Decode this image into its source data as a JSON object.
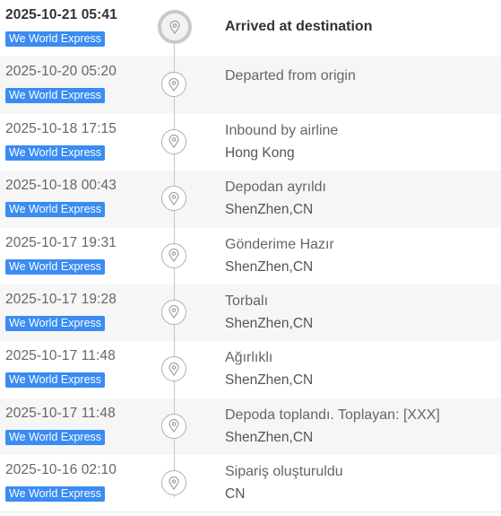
{
  "tracking": {
    "events": [
      {
        "time": "2025-10-21 05:41",
        "carrier": "We World Express",
        "status": "Arrived at destination",
        "location": ""
      },
      {
        "time": "2025-10-20 05:20",
        "carrier": "We World Express",
        "status": "Departed from origin",
        "location": ""
      },
      {
        "time": "2025-10-18 17:15",
        "carrier": "We World Express",
        "status": "Inbound by airline",
        "location": "Hong Kong"
      },
      {
        "time": "2025-10-18 00:43",
        "carrier": "We World Express",
        "status": "Depodan ayrıldı",
        "location": "ShenZhen,CN"
      },
      {
        "time": "2025-10-17 19:31",
        "carrier": "We World Express",
        "status": "Gönderime Hazır",
        "location": "ShenZhen,CN"
      },
      {
        "time": "2025-10-17 19:28",
        "carrier": "We World Express",
        "status": "Torbalı",
        "location": "ShenZhen,CN"
      },
      {
        "time": "2025-10-17 11:48",
        "carrier": "We World Express",
        "status": "Ağırlıklı",
        "location": "ShenZhen,CN"
      },
      {
        "time": "2025-10-17 11:48",
        "carrier": "We World Express",
        "status": "Depoda toplandı. Toplayan: [XXX]",
        "location": "ShenZhen,CN"
      },
      {
        "time": "2025-10-16 02:10",
        "carrier": "We World Express",
        "status": "Sipariş oluşturuldu",
        "location": "CN"
      }
    ],
    "icon": "location-pin-icon",
    "colors": {
      "badge": "#3a8cf2",
      "line": "#c4c4c4"
    }
  }
}
